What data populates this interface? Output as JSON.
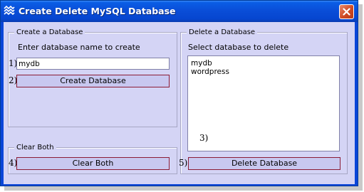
{
  "window": {
    "title": "Create Delete MySQL Database",
    "icon": "app-icon",
    "close_icon": "close-icon"
  },
  "create_group": {
    "title": "Create a Database",
    "prompt": "Enter database name to create",
    "marker_input": "1)",
    "input_value": "mydb",
    "marker_button": "2)",
    "button_label": "Create Database"
  },
  "clear_group": {
    "title": "Clear Both",
    "marker": "4)",
    "button_label": "Clear Both"
  },
  "delete_group": {
    "title": "Delete a Database",
    "prompt": "Select database to delete",
    "databases": [
      "mydb",
      "wordpress"
    ],
    "list_marker": "3)",
    "marker_button": "5)",
    "button_label": "Delete Database"
  },
  "colors": {
    "titlebar": "#0a4ed8",
    "client_background": "#d4d4f5",
    "button_background": "#c8c8f0",
    "button_border": "#8b1c36",
    "close_button": "#cf4a23"
  }
}
